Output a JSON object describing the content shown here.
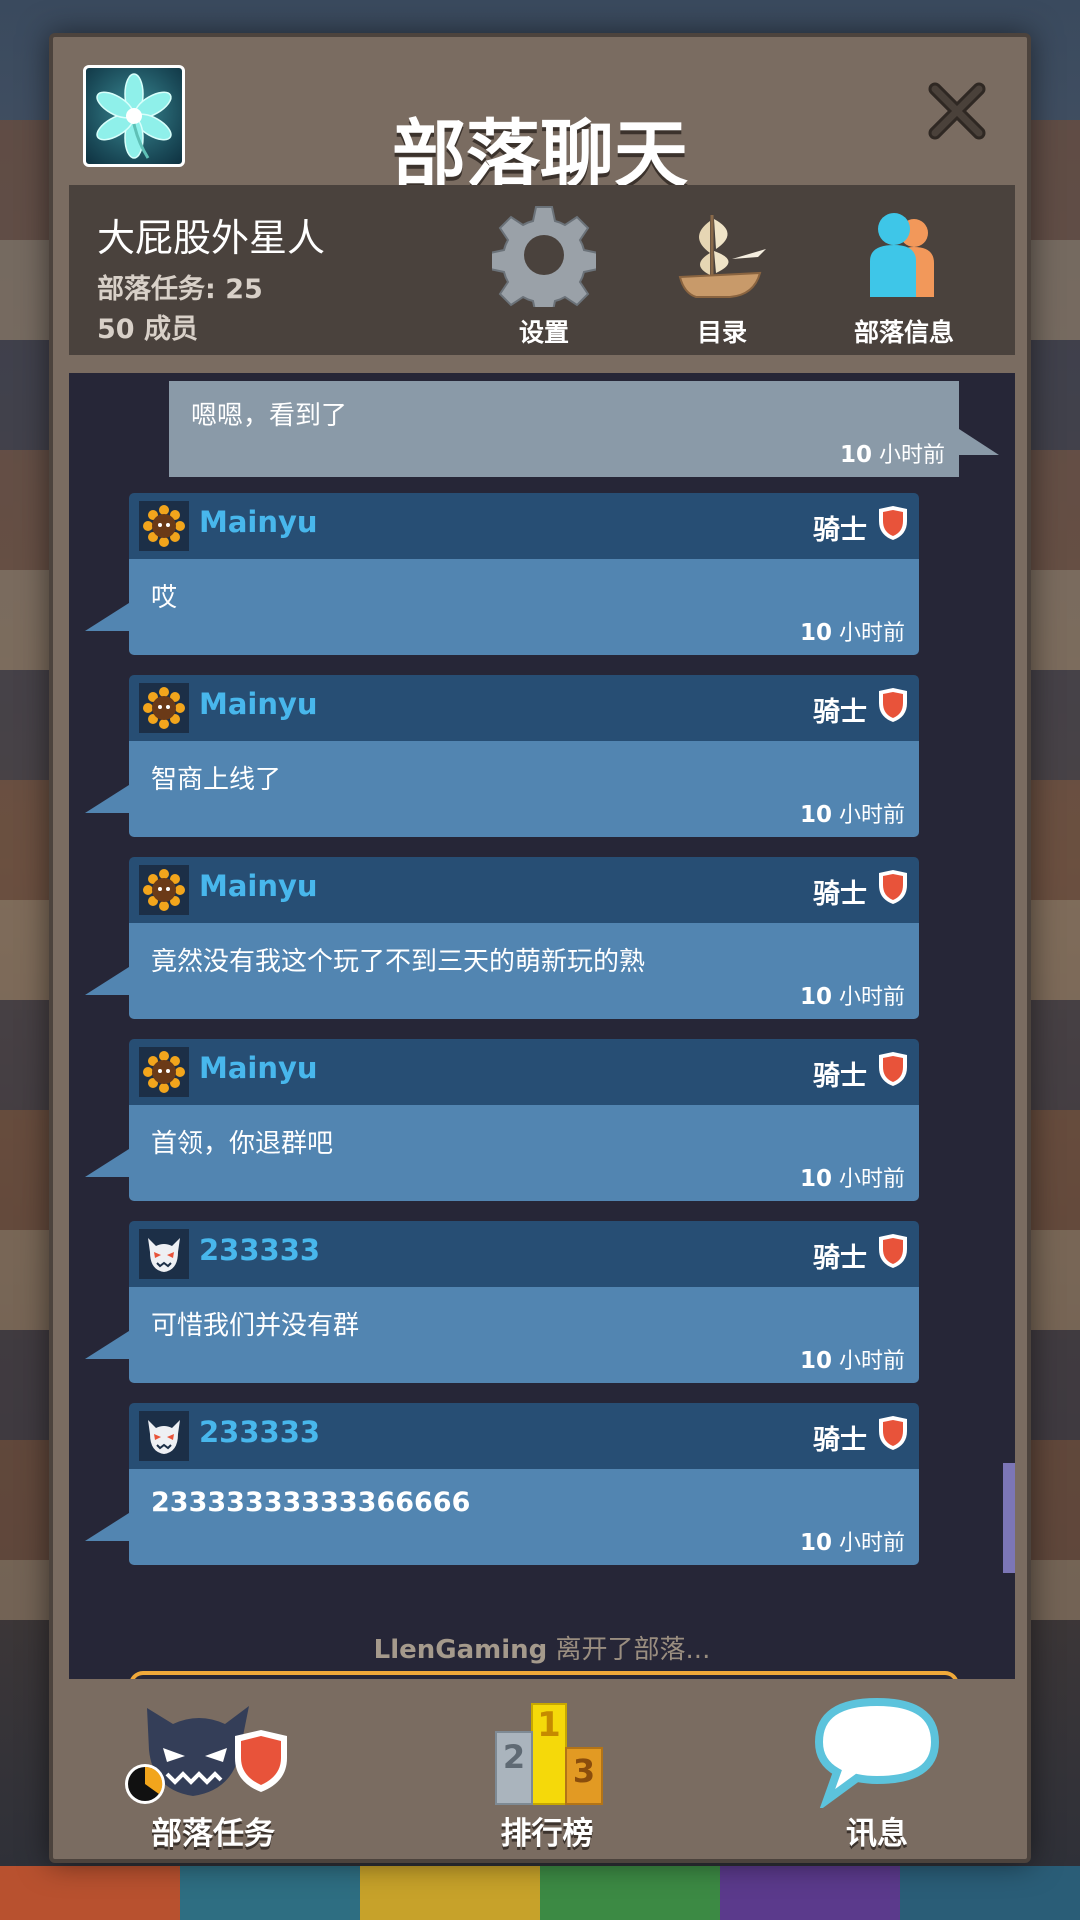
{
  "header": {
    "title": "部落聊天"
  },
  "clan": {
    "name": "大屁股外星人",
    "tasks_label": "部落任务: 25",
    "members_label": "50 成员"
  },
  "info_buttons": {
    "settings": "设置",
    "directory": "目录",
    "clan_info": "部落信息"
  },
  "own_message": {
    "text": "嗯嗯，看到了",
    "time_num": "10",
    "time_unit": " 小时前"
  },
  "messages": [
    {
      "user": "Mainyu",
      "avatar_icon": "sunflower-icon",
      "rank": "骑士",
      "text": "哎",
      "time_num": "10",
      "time_unit": " 小时前"
    },
    {
      "user": "Mainyu",
      "avatar_icon": "sunflower-icon",
      "rank": "骑士",
      "text": "智商上线了",
      "time_num": "10",
      "time_unit": " 小时前"
    },
    {
      "user": "Mainyu",
      "avatar_icon": "sunflower-icon",
      "rank": "骑士",
      "text": "竟然没有我这个玩了不到三天的萌新玩的熟",
      "time_num": "10",
      "time_unit": " 小时前"
    },
    {
      "user": "Mainyu",
      "avatar_icon": "sunflower-icon",
      "rank": "骑士",
      "text": "首领，你退群吧",
      "time_num": "10",
      "time_unit": " 小时前"
    },
    {
      "user": "233333",
      "avatar_icon": "demon-mask-icon",
      "rank": "骑士",
      "text": "可惜我们并没有群",
      "time_num": "10",
      "time_unit": " 小时前"
    },
    {
      "user": "233333",
      "avatar_icon": "demon-mask-icon",
      "rank": "骑士",
      "text": "23333333333366666",
      "time_num": "10",
      "time_unit": " 小时前"
    }
  ],
  "system_message": {
    "user": "LlenGaming",
    "text": " 离开了部落..."
  },
  "bottom_nav": {
    "tasks": "部落任务",
    "leaderboard": "排行榜",
    "messages": "讯息"
  },
  "leaderboard_icon": {
    "first": "1",
    "second": "2",
    "third": "3"
  },
  "colors": {
    "username": "#48b7ec",
    "message_header": "#274e74",
    "message_body": "#5285b1",
    "own_message": "#8a9aa8",
    "panel": "#7a6c61",
    "rank_shield": "#e8533a"
  }
}
